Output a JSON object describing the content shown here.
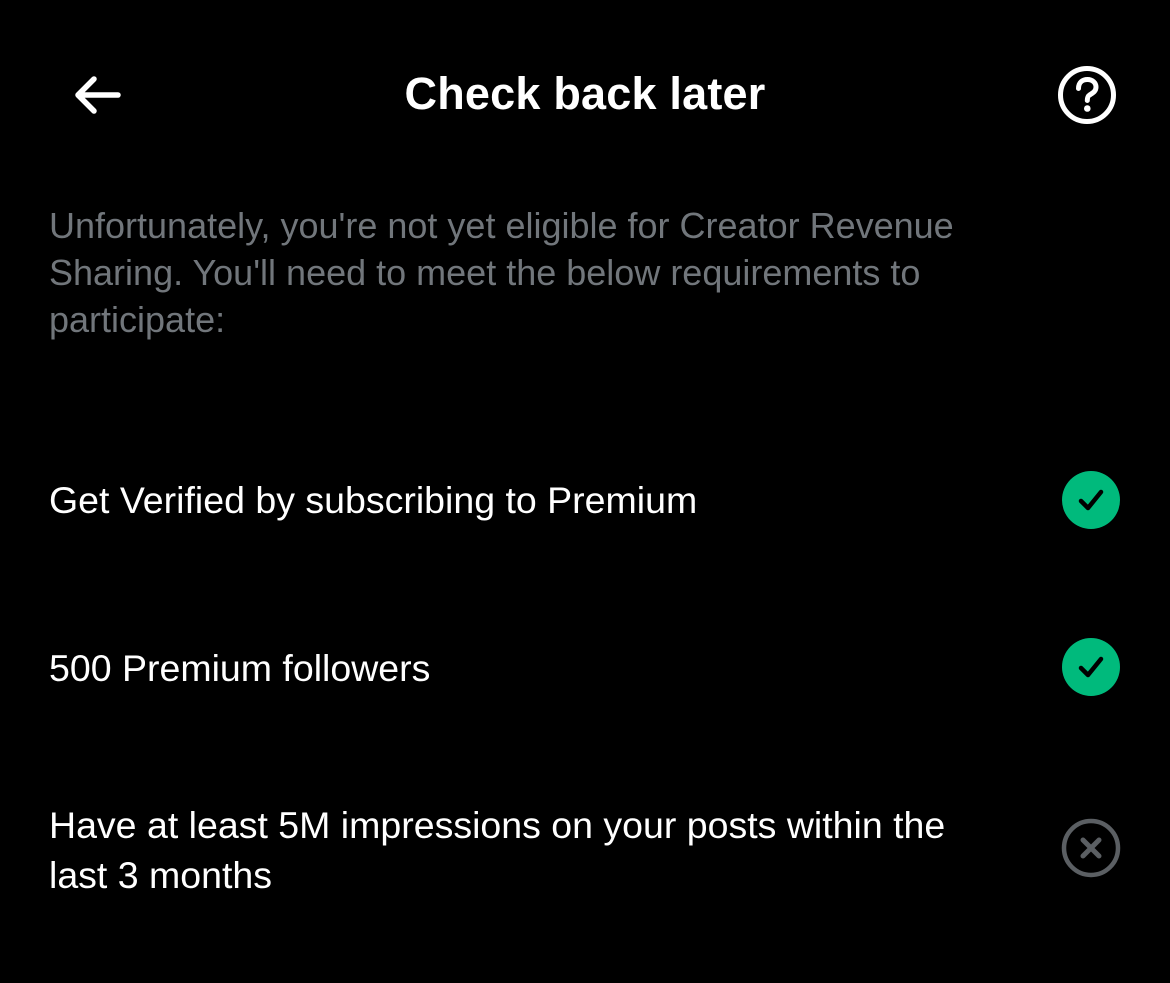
{
  "header": {
    "title": "Check back later",
    "back_icon": "arrow-left-icon",
    "help_icon": "question-circle-icon"
  },
  "description": "Unfortunately, you're not yet eligible for Creator Revenue Sharing. You'll need to meet the below requirements to participate:",
  "requirements": [
    {
      "label": "Get Verified by subscribing to Premium",
      "status": "met",
      "status_icon": "check-circle-icon"
    },
    {
      "label": "500 Premium followers",
      "status": "met",
      "status_icon": "check-circle-icon"
    },
    {
      "label": "Have at least 5M impressions on your posts within the last 3 months",
      "status": "not-met",
      "status_icon": "x-circle-icon"
    }
  ],
  "colors": {
    "background": "#000000",
    "text_primary": "#ffffff",
    "text_secondary": "#71767b",
    "met": "#00ba7c",
    "not_met": "#5b5f63"
  }
}
